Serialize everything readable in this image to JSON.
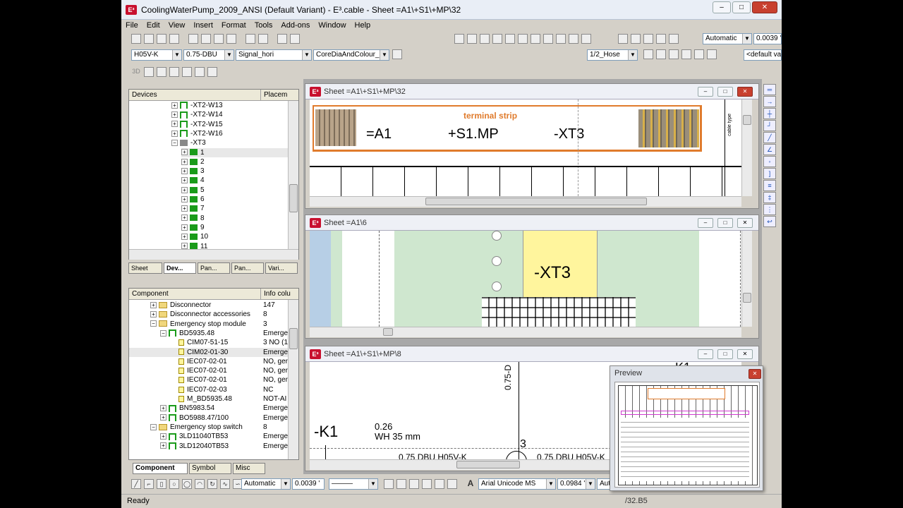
{
  "window": {
    "title": "CoolingWaterPump_2009_ANSI (Default Variant) - E³.cable - Sheet =A1\\+S1\\+MP\\32",
    "logo": "E³",
    "min": "–",
    "max": "□",
    "close": "✕"
  },
  "menu": [
    "File",
    "Edit",
    "View",
    "Insert",
    "Format",
    "Tools",
    "Add-ons",
    "Window",
    "Help"
  ],
  "toolbar2": {
    "wire_type": "H05V-K",
    "cross_section": "0.75-DBU",
    "signal": "Signal_hori",
    "core": "CoreDiaAndColour_",
    "hose": "1/2_Hose",
    "default_va": "<default va",
    "automatic": "Automatic",
    "value": "0.0039 '"
  },
  "toolbar3_label": "3D",
  "devices_panel": {
    "header_col1": "Devices",
    "header_col2": "Placem",
    "items": [
      {
        "label": "-XT2-W13",
        "type": "cable",
        "indent": 1
      },
      {
        "label": "-XT2-W14",
        "type": "cable",
        "indent": 1
      },
      {
        "label": "-XT2-W15",
        "type": "cable",
        "indent": 1
      },
      {
        "label": "-XT2-W16",
        "type": "cable",
        "indent": 1
      },
      {
        "label": "-XT3",
        "type": "strip",
        "indent": 1
      },
      {
        "label": "1",
        "type": "terminal",
        "indent": 2
      },
      {
        "label": "2",
        "type": "terminal",
        "indent": 2
      },
      {
        "label": "3",
        "type": "terminal",
        "indent": 2
      },
      {
        "label": "4",
        "type": "terminal",
        "indent": 2
      },
      {
        "label": "5",
        "type": "terminal",
        "indent": 2
      },
      {
        "label": "6",
        "type": "terminal",
        "indent": 2
      },
      {
        "label": "7",
        "type": "terminal",
        "indent": 2
      },
      {
        "label": "8",
        "type": "terminal",
        "indent": 2
      },
      {
        "label": "9",
        "type": "terminal",
        "indent": 2
      },
      {
        "label": "10",
        "type": "terminal",
        "indent": 2
      },
      {
        "label": "11",
        "type": "terminal",
        "indent": 2
      }
    ],
    "tabs": [
      "Sheet",
      "Dev...",
      "Pan...",
      "Pan...",
      "Vari..."
    ]
  },
  "component_panel": {
    "header_col1": "Component",
    "header_col2": "Info colu",
    "items": [
      {
        "label": "Disconnector",
        "info": "147",
        "type": "folder",
        "indent": 0
      },
      {
        "label": "Disconnector accessories",
        "info": "8",
        "type": "folder",
        "indent": 0
      },
      {
        "label": "Emergency stop module",
        "info": "3",
        "type": "folder",
        "indent": 0
      },
      {
        "label": "BD5935.48",
        "info": "Emerge",
        "type": "comp",
        "indent": 1
      },
      {
        "label": "CIM07-51-15",
        "info": "3 NO (1...",
        "type": "sym",
        "indent": 2
      },
      {
        "label": "CIM02-01-30",
        "info": "Emerge",
        "type": "sym",
        "indent": 2
      },
      {
        "label": "IEC07-02-01",
        "info": "NO, ger",
        "type": "sym",
        "indent": 2
      },
      {
        "label": "IEC07-02-01",
        "info": "NO, ger",
        "type": "sym",
        "indent": 2
      },
      {
        "label": "IEC07-02-01",
        "info": "NO, ger",
        "type": "sym",
        "indent": 2
      },
      {
        "label": "IEC07-02-03",
        "info": "NC",
        "type": "sym",
        "indent": 2
      },
      {
        "label": "M_BD5935.48",
        "info": "NOT-AI",
        "type": "sym",
        "indent": 2
      },
      {
        "label": "BN5983.54",
        "info": "Emerge",
        "type": "comp",
        "indent": 1
      },
      {
        "label": "BO5988.47/100",
        "info": "Emerge",
        "type": "comp",
        "indent": 1
      },
      {
        "label": "Emergency stop switch",
        "info": "8",
        "type": "folder",
        "indent": 0
      },
      {
        "label": "3LD11040TB53",
        "info": "Emerge",
        "type": "comp",
        "indent": 1
      },
      {
        "label": "3LD12040TB53",
        "info": "Emerge",
        "type": "comp",
        "indent": 1
      }
    ],
    "tabs": [
      "Component",
      "Symbol",
      "Misc"
    ]
  },
  "sheet1": {
    "title": "Sheet =A1\\+S1\\+MP\\32",
    "banner_title": "terminal strip",
    "a1": "=A1",
    "s1": "+S1.MP",
    "xt3": "-XT3",
    "side_label": "cable type"
  },
  "sheet2": {
    "title": "Sheet =A1\\6",
    "label": "-XT3"
  },
  "sheet3": {
    "title": "Sheet =A1\\+S1\\+MP\\8",
    "k1": "-K1",
    "k1_top": "-K1",
    "vert": "0.75-D",
    "num1": "0.26",
    "wh": "WH 35 mm",
    "three": "3",
    "dbu1": "0.75 DBU  H05V-K",
    "dbu2": "0.75 DBU  H05V-K"
  },
  "preview": {
    "title": "Preview",
    "close": "✕"
  },
  "bottom_toolbar": {
    "automatic": "Automatic",
    "value": "0.0039 '",
    "font": "Arial Unicode MS",
    "size": "0.0984 '",
    "aut": "Aut"
  },
  "status": {
    "ready": "Ready",
    "sheet_ref": "/32.B5"
  },
  "colors": {
    "accent_red": "#c8102e",
    "banner_orange": "#e07b2c",
    "sheet_green": "#cfe7cf",
    "sheet_yellow": "#fff59d"
  }
}
